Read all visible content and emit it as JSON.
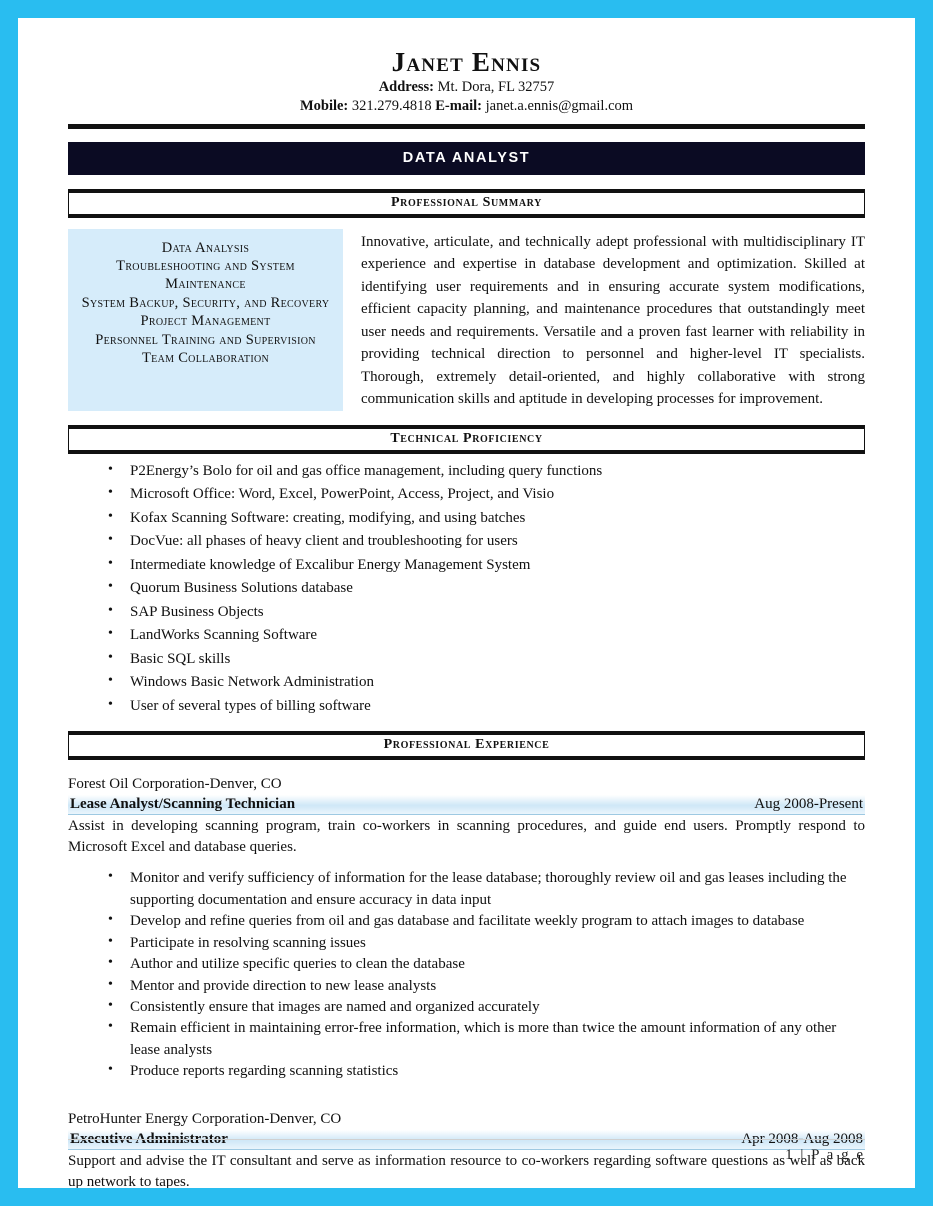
{
  "document": {
    "type": "resume",
    "accent_border_color": "#29bdf0",
    "banner_color": "#0b0b23",
    "core_box_color": "#d6ecfa",
    "job_bar_color": "#cfe7f7"
  },
  "header": {
    "name": "Janet Ennis",
    "address_label": "Address:",
    "address_value": "Mt. Dora, FL 32757",
    "mobile_label": "Mobile:",
    "mobile_value": "321.279.4818",
    "email_label": "E-mail:",
    "email_value": "janet.a.ennis@gmail.com",
    "role_banner": "DATA ANALYST"
  },
  "sections": {
    "summary_heading": "Professional Summary",
    "technical_heading": "Technical Proficiency",
    "experience_heading": "Professional Experience"
  },
  "core_competencies": [
    "Data Analysis",
    "Troubleshooting and System Maintenance",
    "System Backup, Security, and Recovery",
    "Project Management",
    "Personnel Training and Supervision",
    "Team Collaboration"
  ],
  "summary_text": "Innovative, articulate, and technically adept professional with multidisciplinary IT experience and expertise in database development and optimization. Skilled at identifying user requirements and in ensuring accurate system modifications, efficient capacity planning, and maintenance procedures that outstandingly meet user needs and requirements. Versatile and a proven fast learner with reliability in providing technical direction to personnel and higher-level IT specialists. Thorough, extremely detail-oriented, and highly collaborative with strong communication skills and aptitude in developing processes for improvement.",
  "technical_proficiency": [
    "P2Energy’s Bolo for oil and gas office management, including query functions",
    "Microsoft Office: Word, Excel, PowerPoint, Access, Project, and Visio",
    "Kofax Scanning Software: creating, modifying, and using batches",
    "DocVue: all phases of heavy client and troubleshooting for users",
    "Intermediate knowledge of Excalibur Energy Management System",
    "Quorum Business Solutions database",
    "SAP Business Objects",
    "LandWorks Scanning Software",
    "Basic SQL skills",
    "Windows Basic Network Administration",
    "User of several types of billing software"
  ],
  "experience": [
    {
      "company": "Forest Oil Corporation-Denver, CO",
      "title": "Lease Analyst/Scanning Technician",
      "dates": "Aug 2008-Present",
      "description": "Assist in developing scanning program, train co-workers in scanning procedures, and guide end users. Promptly respond to Microsoft Excel and database queries.",
      "bullets": [
        "Monitor and verify sufficiency of information for the lease database; thoroughly review oil and gas leases including the supporting documentation and ensure accuracy in data input",
        "Develop and refine queries from oil and gas database and facilitate weekly program to attach images to database",
        "Participate in resolving scanning issues",
        "Author and utilize specific queries to clean the database",
        "Mentor and provide direction to new lease analysts",
        "Consistently ensure that images are named and organized accurately",
        "Remain efficient in maintaining error-free information, which is more than twice the amount information of any other lease analysts",
        "Produce reports regarding scanning statistics"
      ]
    },
    {
      "company": "PetroHunter Energy Corporation-Denver, CO",
      "title": "Executive Administrator",
      "dates": "Apr 2008-Aug 2008",
      "description": "Support and advise the IT consultant and serve as information resource to co-workers regarding software questions as well as back up network to tapes.",
      "bullets": []
    }
  ],
  "footer": {
    "page_number": "1 | P a g e"
  }
}
